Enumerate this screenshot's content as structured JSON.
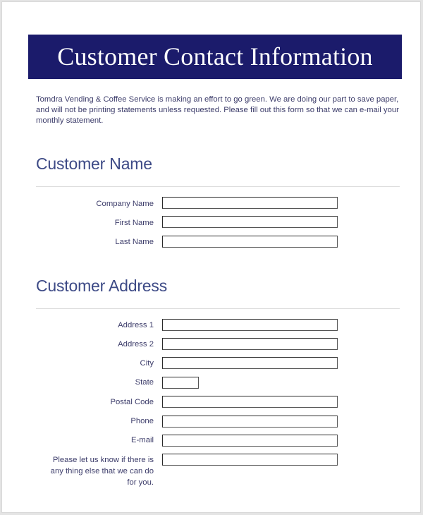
{
  "header": {
    "title": "Customer Contact Information",
    "color": "#1b1b6b"
  },
  "intro": "Tomdra Vending & Coffee Service is making an effort to go green. We are doing our part to save paper, and will not be printing statements unless requested. Please fill out this form so that we can e-mail your monthly statement.",
  "sections": {
    "name": {
      "title": "Customer Name",
      "fields": [
        {
          "label": "Company Name",
          "value": ""
        },
        {
          "label": "First Name",
          "value": ""
        },
        {
          "label": "Last Name",
          "value": ""
        }
      ]
    },
    "address": {
      "title": "Customer Address",
      "fields": [
        {
          "label": "Address 1",
          "value": ""
        },
        {
          "label": "Address 2",
          "value": ""
        },
        {
          "label": "City",
          "value": ""
        },
        {
          "label": "State",
          "value": ""
        },
        {
          "label": "Postal Code",
          "value": ""
        },
        {
          "label": "Phone",
          "value": ""
        },
        {
          "label": "E-mail",
          "value": ""
        },
        {
          "label": "Please let us know if there is any thing else that we can do for you.",
          "value": ""
        }
      ]
    }
  }
}
